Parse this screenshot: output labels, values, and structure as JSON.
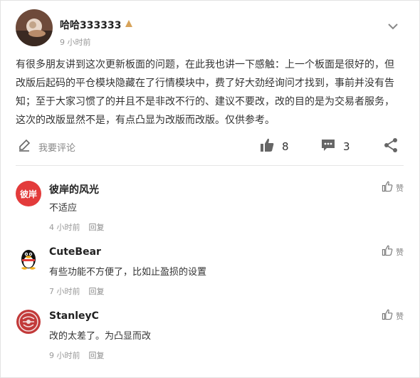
{
  "post": {
    "author": "哈哈333333",
    "time": "9 小时前",
    "body": "有很多朋友讲到这次更新板面的问题，在此我也讲一下感触：上一个板面是很好的，但改版后起码的平仓模块隐藏在了行情模块中，费了好大劲经询问才找到，事前并没有告知；至于大家习惯了的并且不是非改不行的、建议不要改，改的目的是为交易者服务，这次的改版显然不是，有点凸显为改版而改版。仅供参考。",
    "comment_placeholder": "我要评论",
    "like_count": "8",
    "comment_count": "3"
  },
  "comments": [
    {
      "avatar_text": "彼岸",
      "author": "彼岸的风光",
      "text": "不适应",
      "time": "4 小时前",
      "reply": "回复",
      "like_label": "赞"
    },
    {
      "author": "CuteBear",
      "text": "有些功能不方便了，比如止盈损的设置",
      "time": "7 小时前",
      "reply": "回复",
      "like_label": "赞"
    },
    {
      "author": "StanleyC",
      "text": "改的太差了。为凸显而改",
      "time": "9 小时前",
      "reply": "回复",
      "like_label": "赞"
    }
  ],
  "colors": {
    "accent_red": "#e33b3b",
    "text": "#333333",
    "muted": "#999999",
    "icon": "#555555"
  },
  "icons": [
    "badge-icon",
    "chevron-down-icon",
    "pencil-icon",
    "thumbs-up-icon",
    "comment-bubble-icon",
    "share-icon",
    "penguin-icon",
    "seal-icon"
  ]
}
